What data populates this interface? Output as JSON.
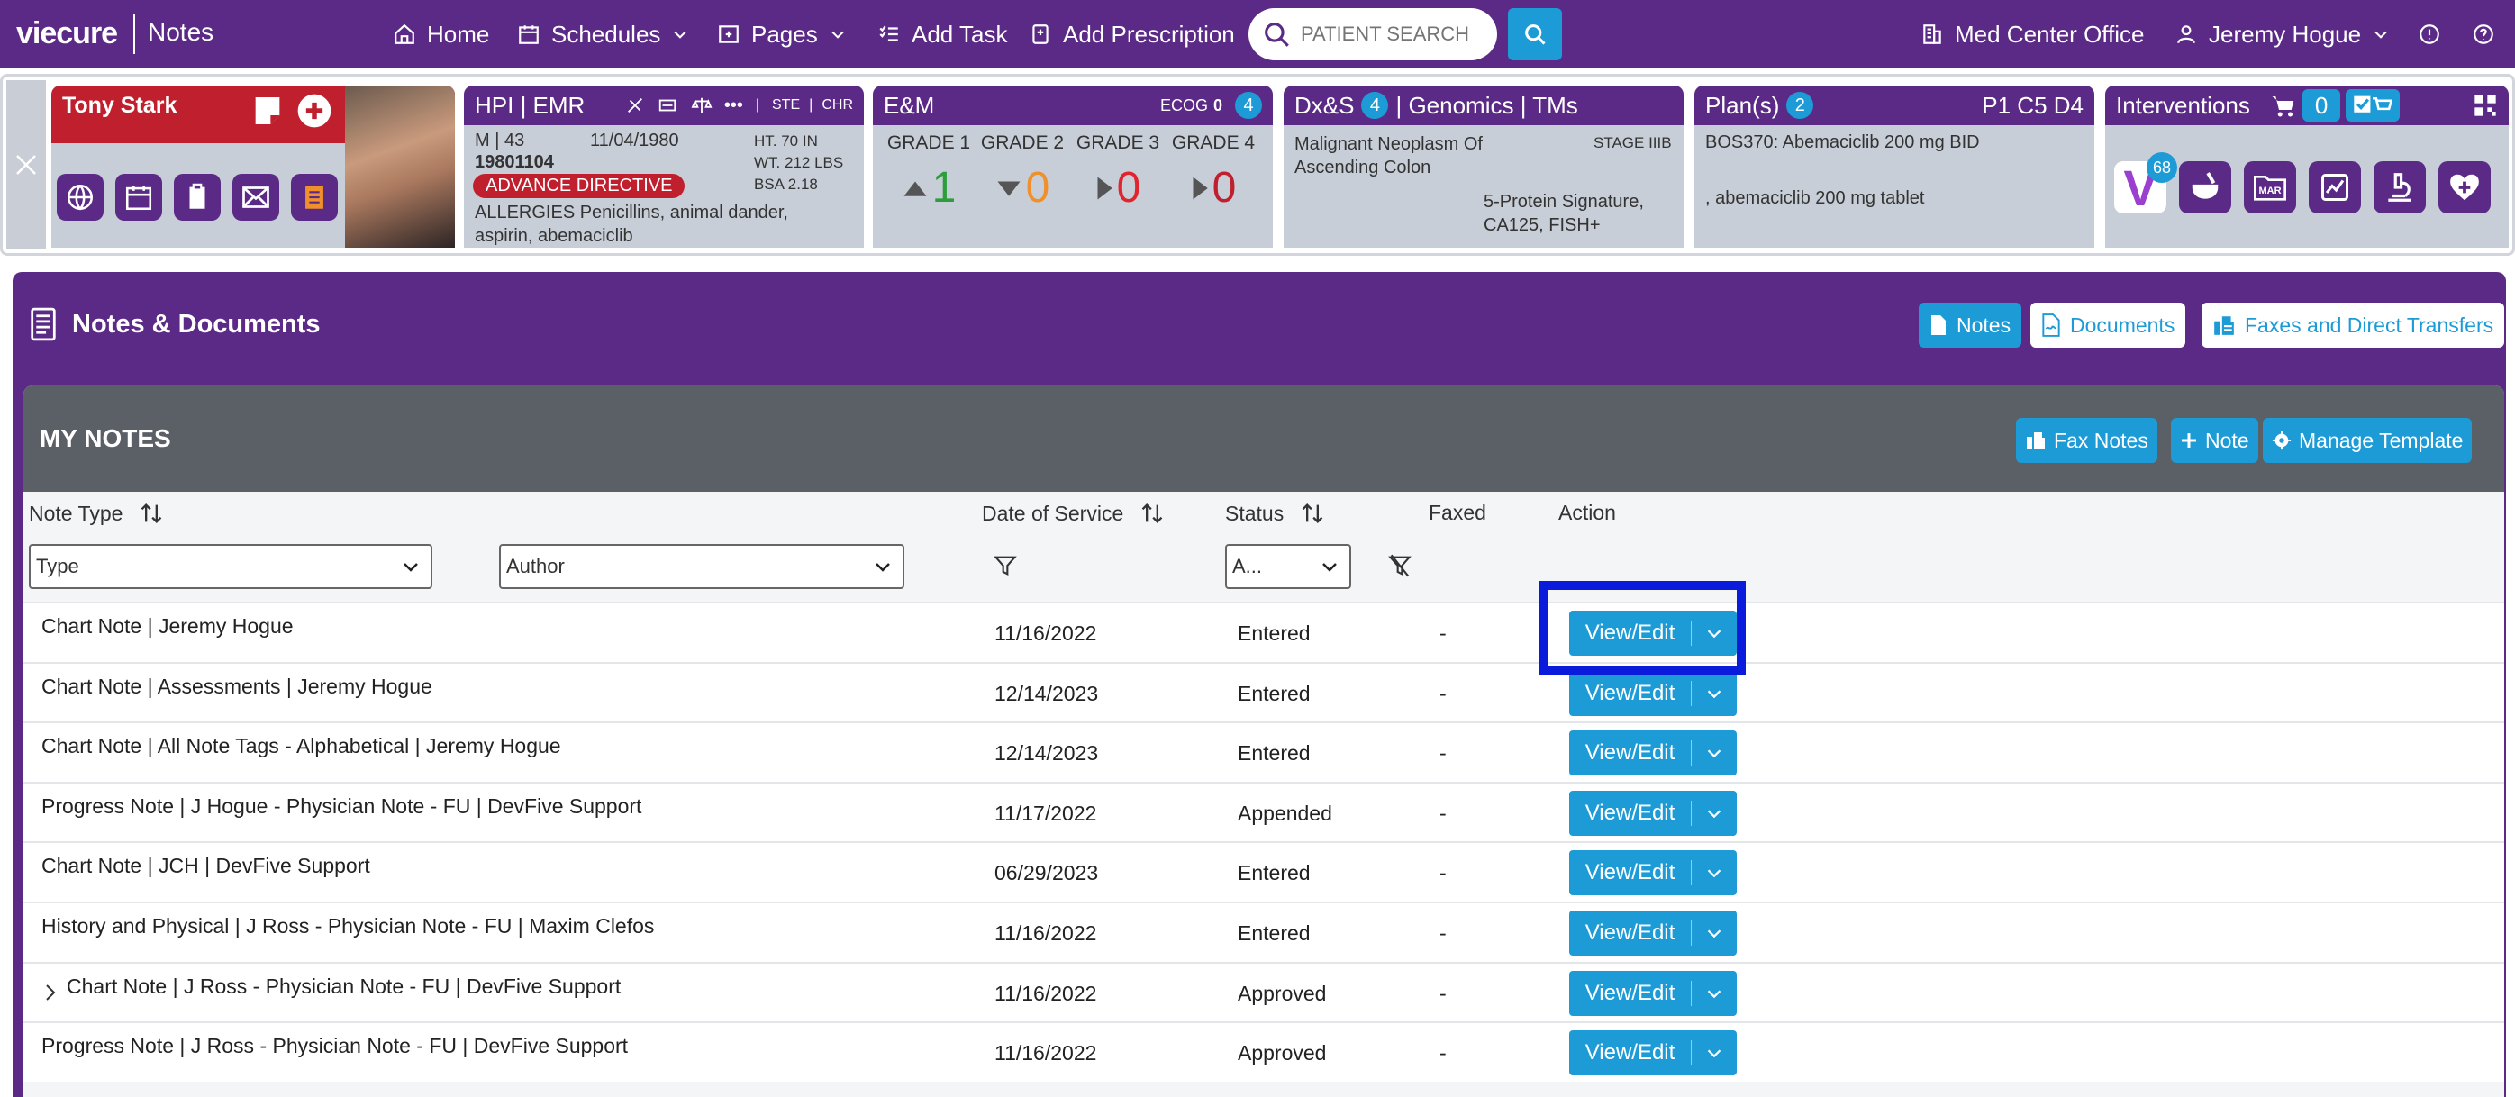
{
  "nav": {
    "brand": "viecure",
    "section": "Notes",
    "items": [
      {
        "label": "Home",
        "icon": "home-icon"
      },
      {
        "label": "Schedules",
        "icon": "calendar-icon"
      },
      {
        "label": "Pages",
        "icon": "pages-icon"
      },
      {
        "label": "Add Task",
        "icon": "task-icon"
      },
      {
        "label": "Add Prescription",
        "icon": "prescription-icon"
      }
    ],
    "search_placeholder": "PATIENT SEARCH",
    "office": "Med Center Office",
    "user": "Jeremy Hogue"
  },
  "patient": {
    "name": "Tony Stark",
    "sex_age": "M | 43",
    "dob": "11/04/1980",
    "mrn": "19801104",
    "height": "HT. 70 IN",
    "weight": "WT. 212 LBS",
    "bsa": "BSA 2.18",
    "advance_directive": "ADVANCE DIRECTIVE",
    "allergies": "ALLERGIES Penicillins, animal dander, aspirin, abemaciclib"
  },
  "hpi": {
    "title": "HPI | EMR",
    "ste": "STE",
    "chr": "CHR"
  },
  "em": {
    "title": "E&M",
    "ecog_label": "ECOG",
    "ecog_value": "0",
    "count": "4",
    "grades": [
      {
        "label": "GRADE 1",
        "value": "1",
        "color": "#2e9e3c"
      },
      {
        "label": "GRADE 2",
        "value": "0",
        "color": "#f0902a"
      },
      {
        "label": "GRADE 3",
        "value": "0",
        "color": "#e0252e"
      },
      {
        "label": "GRADE 4",
        "value": "0",
        "color": "#c0202e"
      }
    ]
  },
  "dx": {
    "title_a": "Dx&S",
    "count": "4",
    "title_b": "| Genomics | TMs",
    "diagnosis": "Malignant Neoplasm Of Ascending Colon",
    "stage": "STAGE IIIB",
    "genomics": "5-Protein Signature, CA125, FISH+"
  },
  "plan": {
    "title": "Plan(s)",
    "count": "2",
    "cycle": "P1 C5 D4",
    "regimen": "BOS370: Abemaciclib 200 mg BID",
    "drug": ", abemaciclib 200 mg tablet"
  },
  "interventions": {
    "title": "Interventions",
    "cart_count": "0",
    "v_badge": "68",
    "mar": "MAR"
  },
  "notes_docs": {
    "title": "Notes & Documents",
    "tabs": [
      "Notes",
      "Documents",
      "Faxes and Direct Transfers"
    ]
  },
  "my_notes": {
    "title": "MY NOTES",
    "buttons": [
      "Fax Notes",
      "Note",
      "Manage Template"
    ],
    "columns": {
      "type": "Note Type",
      "date": "Date of Service",
      "status": "Status",
      "faxed": "Faxed",
      "action": "Action"
    },
    "filters": {
      "type": "Type",
      "author": "Author",
      "status": "A..."
    },
    "action_label": "View/Edit",
    "rows": [
      {
        "type": "Chart Note | Jeremy Hogue",
        "date": "11/16/2022",
        "status": "Entered",
        "faxed": "-"
      },
      {
        "type": "Chart Note | Assessments | Jeremy Hogue",
        "date": "12/14/2023",
        "status": "Entered",
        "faxed": "-"
      },
      {
        "type": "Chart Note | All Note Tags - Alphabetical | Jeremy Hogue",
        "date": "12/14/2023",
        "status": "Entered",
        "faxed": "-"
      },
      {
        "type": "Progress Note | J Hogue - Physician Note - FU | DevFive Support",
        "date": "11/17/2022",
        "status": "Appended",
        "faxed": "-"
      },
      {
        "type": "Chart Note | JCH | DevFive Support",
        "date": "06/29/2023",
        "status": "Entered",
        "faxed": "-"
      },
      {
        "type": "History and Physical | J Ross - Physician Note - FU | Maxim Clefos",
        "date": "11/16/2022",
        "status": "Entered",
        "faxed": "-"
      },
      {
        "type": "Chart Note | J Ross - Physician Note - FU | DevFive Support",
        "date": "11/16/2022",
        "status": "Approved",
        "faxed": "-"
      },
      {
        "type": "Progress Note | J Ross - Physician Note - FU | DevFive Support",
        "date": "11/16/2022",
        "status": "Approved",
        "faxed": "-"
      }
    ]
  },
  "colors": {
    "purple": "#5b2a86",
    "blue": "#1d9bd7",
    "red": "#c0202e",
    "highlight": "#0a1bdc"
  }
}
